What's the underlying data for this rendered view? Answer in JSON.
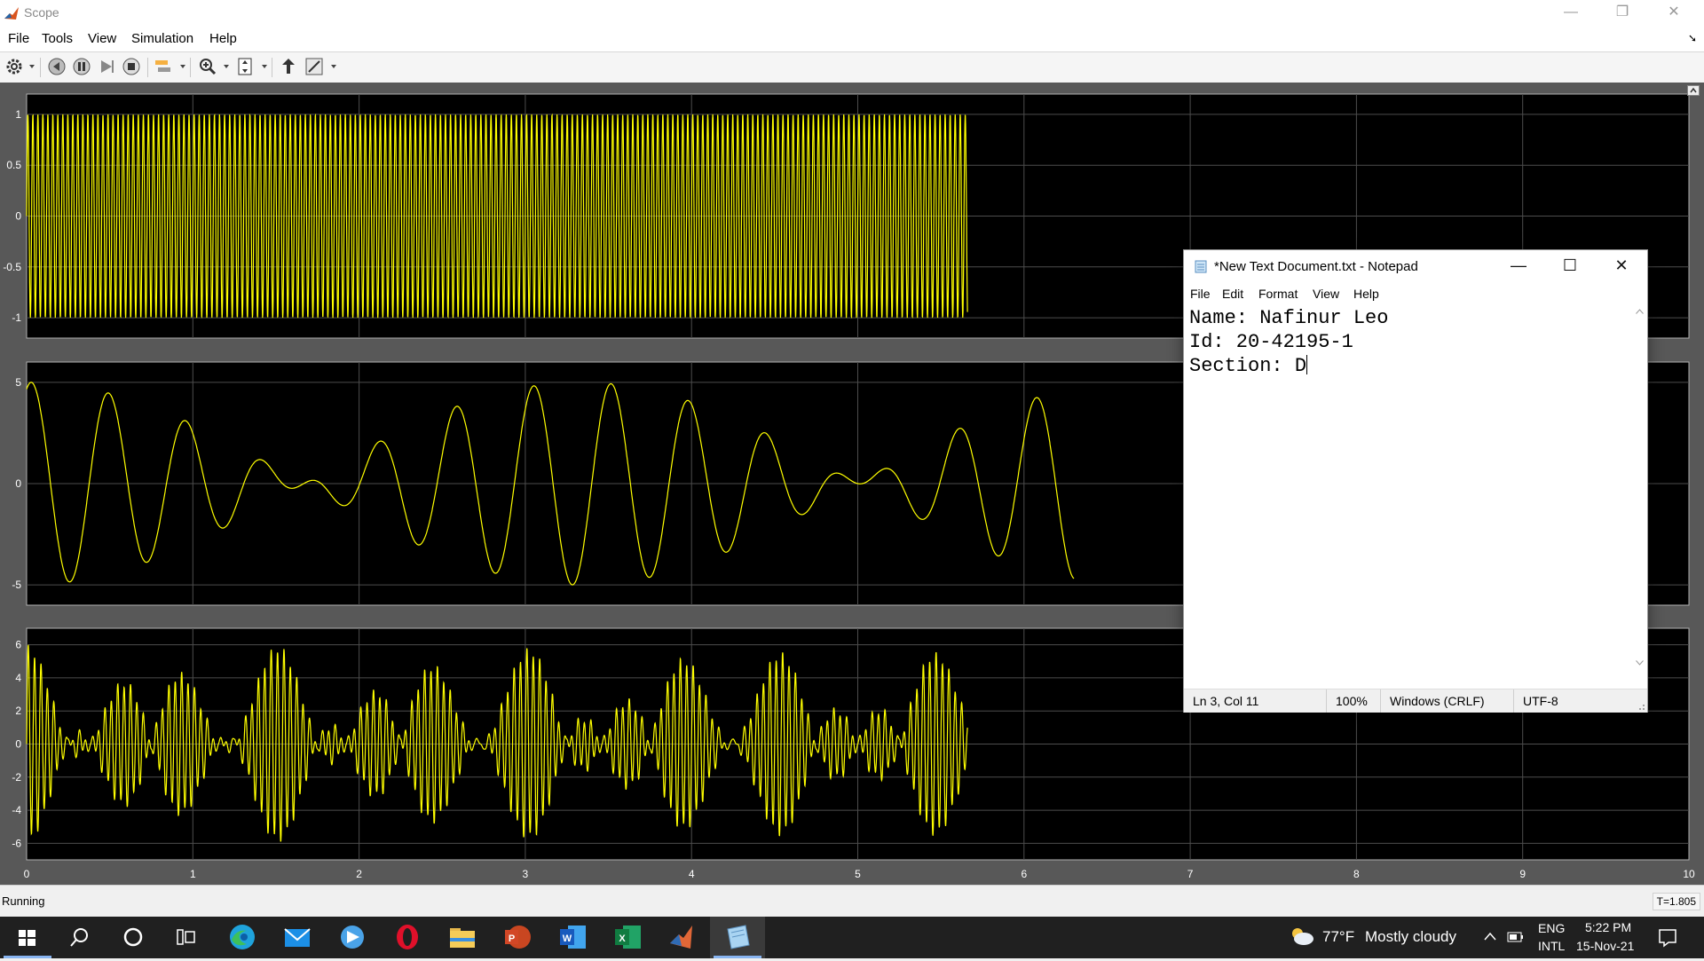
{
  "window": {
    "title": "Scope"
  },
  "menu": [
    "File",
    "Tools",
    "View",
    "Simulation",
    "Help"
  ],
  "toolbar": [
    "settings-icon",
    "step-back-icon",
    "pause-icon",
    "step-forward-icon",
    "stop-icon",
    "highlight-icon",
    "zoom-icon",
    "autoscale-icon",
    "restore-layout-icon",
    "style-icon"
  ],
  "scope": {
    "x_ticks": [
      "0",
      "1",
      "2",
      "3",
      "4",
      "5",
      "6",
      "7",
      "8",
      "9",
      "10"
    ],
    "plots": [
      {
        "yticks": [
          {
            "label": "1",
            "value": 1
          },
          {
            "label": "0.5",
            "value": 0.5
          },
          {
            "label": "0",
            "value": 0
          },
          {
            "label": "-0.5",
            "value": -0.5
          },
          {
            "label": "-1",
            "value": -1
          }
        ],
        "ylim": [
          -1.2,
          1.2
        ]
      },
      {
        "yticks": [
          {
            "label": "5",
            "value": 5
          },
          {
            "label": "0",
            "value": 0
          },
          {
            "label": "-5",
            "value": -5
          }
        ],
        "ylim": [
          -6,
          6
        ]
      },
      {
        "yticks": [
          {
            "label": "6",
            "value": 6
          },
          {
            "label": "4",
            "value": 4
          },
          {
            "label": "2",
            "value": 2
          },
          {
            "label": "0",
            "value": 0
          },
          {
            "label": "-2",
            "value": -2
          },
          {
            "label": "-4",
            "value": -4
          },
          {
            "label": "-6",
            "value": -6
          }
        ],
        "ylim": [
          -7,
          7
        ]
      }
    ],
    "line_color": "#ffff00",
    "background": "#000000"
  },
  "chart_data": [
    {
      "type": "line",
      "xlim": [
        0,
        10
      ],
      "ylim": [
        -1.2,
        1.2
      ],
      "series": [
        {
          "x": [
            0,
            5.66
          ],
          "y_range": [
            -1,
            1
          ]
        }
      ]
    },
    {
      "type": "line",
      "xlim": [
        0,
        10
      ],
      "ylim": [
        -6,
        6
      ],
      "series": [
        {
          "x": [
            0,
            6.3
          ],
          "y_range": [
            -5,
            5
          ]
        }
      ]
    },
    {
      "type": "line",
      "xlim": [
        0,
        10
      ],
      "ylim": [
        -7,
        7
      ],
      "series": [
        {
          "x": [
            0,
            5.66
          ],
          "y_range": [
            -5.8,
            5.8
          ]
        }
      ]
    }
  ],
  "status": {
    "left": "Running",
    "right": "T=1.805"
  },
  "notepad": {
    "title": "*New Text Document.txt - Notepad",
    "menu": [
      "File",
      "Edit",
      "Format",
      "View",
      "Help"
    ],
    "lines": [
      "Name: Nafinur Leo",
      "Id: 20-42195-1",
      "Section: D"
    ],
    "status": {
      "position": "Ln 3, Col 11",
      "zoom": "100%",
      "line_ending": "Windows (CRLF)",
      "encoding": "UTF-8"
    }
  },
  "taskbar": {
    "apps": [
      "windows-start-icon",
      "search-icon",
      "cortana-icon",
      "task-view-icon",
      "edge-icon",
      "mail-icon",
      "photos-icon",
      "opera-icon",
      "file-explorer-icon",
      "powerpoint-icon",
      "word-icon",
      "excel-icon",
      "matlab-icon",
      "notepad-icon"
    ],
    "weather": {
      "temp": "77°F",
      "condition": "Mostly cloudy"
    },
    "language": {
      "line1": "ENG",
      "line2": "INTL"
    },
    "clock": {
      "time": "5:22 PM",
      "date": "15-Nov-21"
    }
  }
}
